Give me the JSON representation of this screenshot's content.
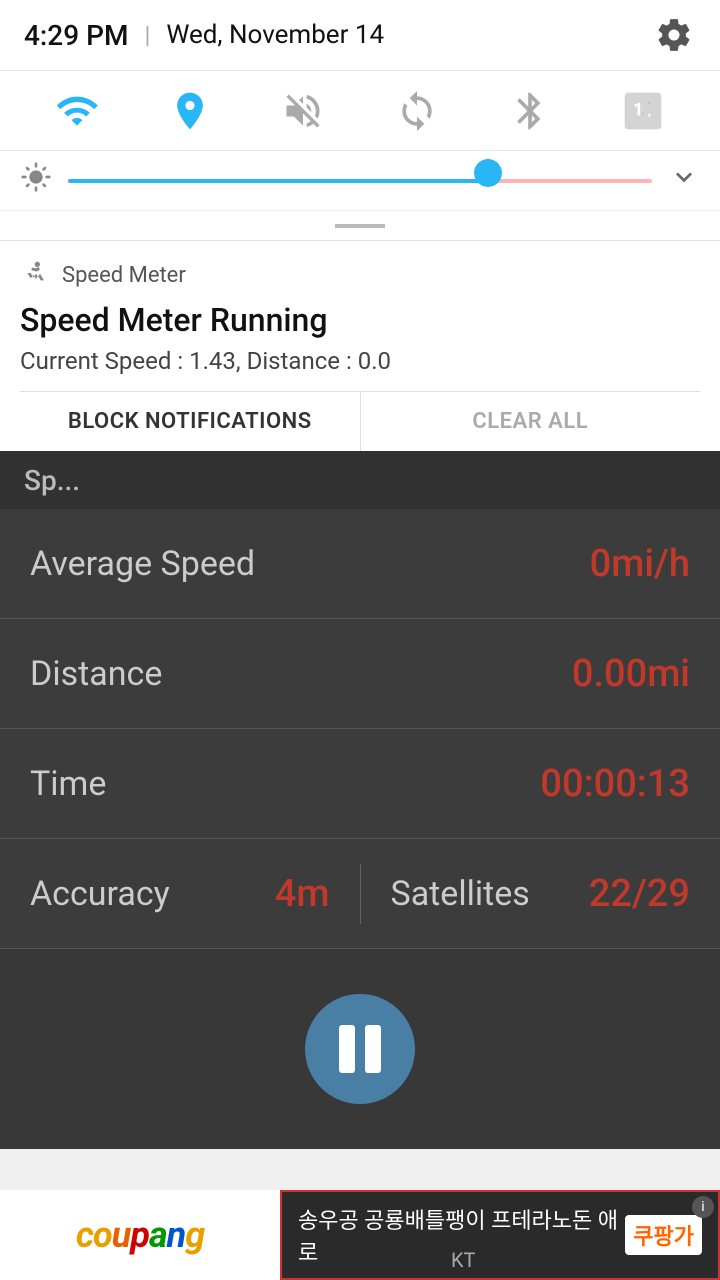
{
  "statusBar": {
    "time": "4:29 PM",
    "divider": "|",
    "date": "Wed, November 14"
  },
  "quickSettings": {
    "wifi": {
      "name": "wifi-icon",
      "active": true,
      "symbol": "📶"
    },
    "location": {
      "name": "location-icon",
      "active": true
    },
    "mute": {
      "name": "mute-icon",
      "active": false
    },
    "sync": {
      "name": "sync-icon",
      "active": false
    },
    "bluetooth": {
      "name": "bluetooth-icon",
      "active": false
    },
    "nfc": {
      "name": "nfc-icon",
      "active": false
    }
  },
  "brightness": {
    "value": 72
  },
  "notification": {
    "appName": "Speed Meter",
    "title": "Speed Meter Running",
    "body": "Current Speed : 1.43,   Distance : 0.0",
    "blockLabel": "BLOCK NOTIFICATIONS",
    "clearLabel": "CLEAR ALL"
  },
  "speedApp": {
    "titleVisible": "Sp...",
    "metrics": [
      {
        "label": "Average Speed",
        "value": "0mi/h"
      },
      {
        "label": "Distance",
        "value": "0.00mi"
      },
      {
        "label": "Time",
        "value": "00:00:13"
      }
    ],
    "accuracy": {
      "label": "Accuracy",
      "value": "4m"
    },
    "satellites": {
      "label": "Satellites",
      "value": "22/29"
    }
  },
  "ad": {
    "leftBrand": "coupang",
    "rightText": "송우공 공룡배틀팽이 프테라노돈 애로",
    "rightLogo": "쿠팡가",
    "carrier": "KT",
    "infoLabel": "i"
  }
}
